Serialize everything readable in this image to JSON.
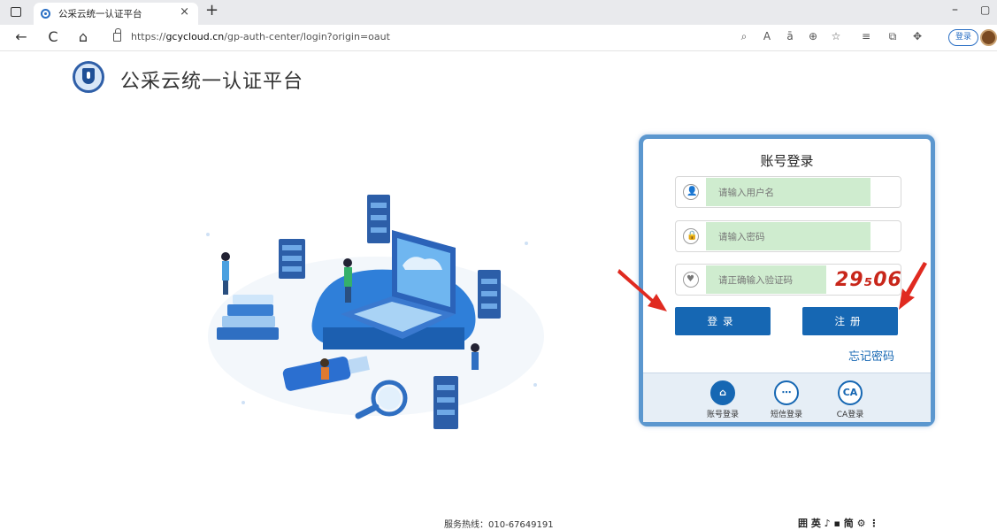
{
  "browser": {
    "tab_title": "公采云统一认证平台",
    "tab_close": "×",
    "tab_new": "+",
    "win_min": "–",
    "win_max": "▢",
    "back": "←",
    "reload": "C",
    "home": "⌂",
    "url_host_prefix": "https://",
    "url_host": "gcycloud.cn",
    "url_path": "/gp-auth-center/login?origin=oaut",
    "login_button": "登录"
  },
  "header": {
    "site_title": "公采云统一认证平台"
  },
  "login_panel": {
    "title": "账号登录",
    "username_placeholder": "请输入用户名",
    "password_placeholder": "请输入密码",
    "captcha_placeholder": "请正确输入验证码",
    "captcha_code": "29₅06",
    "login_button": "登录",
    "register_button": "注册",
    "forgot_password": "忘记密码",
    "options": [
      {
        "label": "账号登录",
        "icon": "lock-icon",
        "active": true
      },
      {
        "label": "短信登录",
        "icon": "message-icon",
        "active": false
      },
      {
        "label": "CA登录",
        "icon": "ca-icon",
        "active": false
      }
    ]
  },
  "footer": {
    "hotline": "服务热线：010-67649191",
    "ime_toolbar": "囲 英 ♪ ▪ 简 ⚙ ⋮"
  },
  "colors": {
    "accent": "#1667b3",
    "panel_border": "#5b97cf",
    "autofill": "#cfeccf",
    "annotation_arrow": "#e02a20"
  }
}
